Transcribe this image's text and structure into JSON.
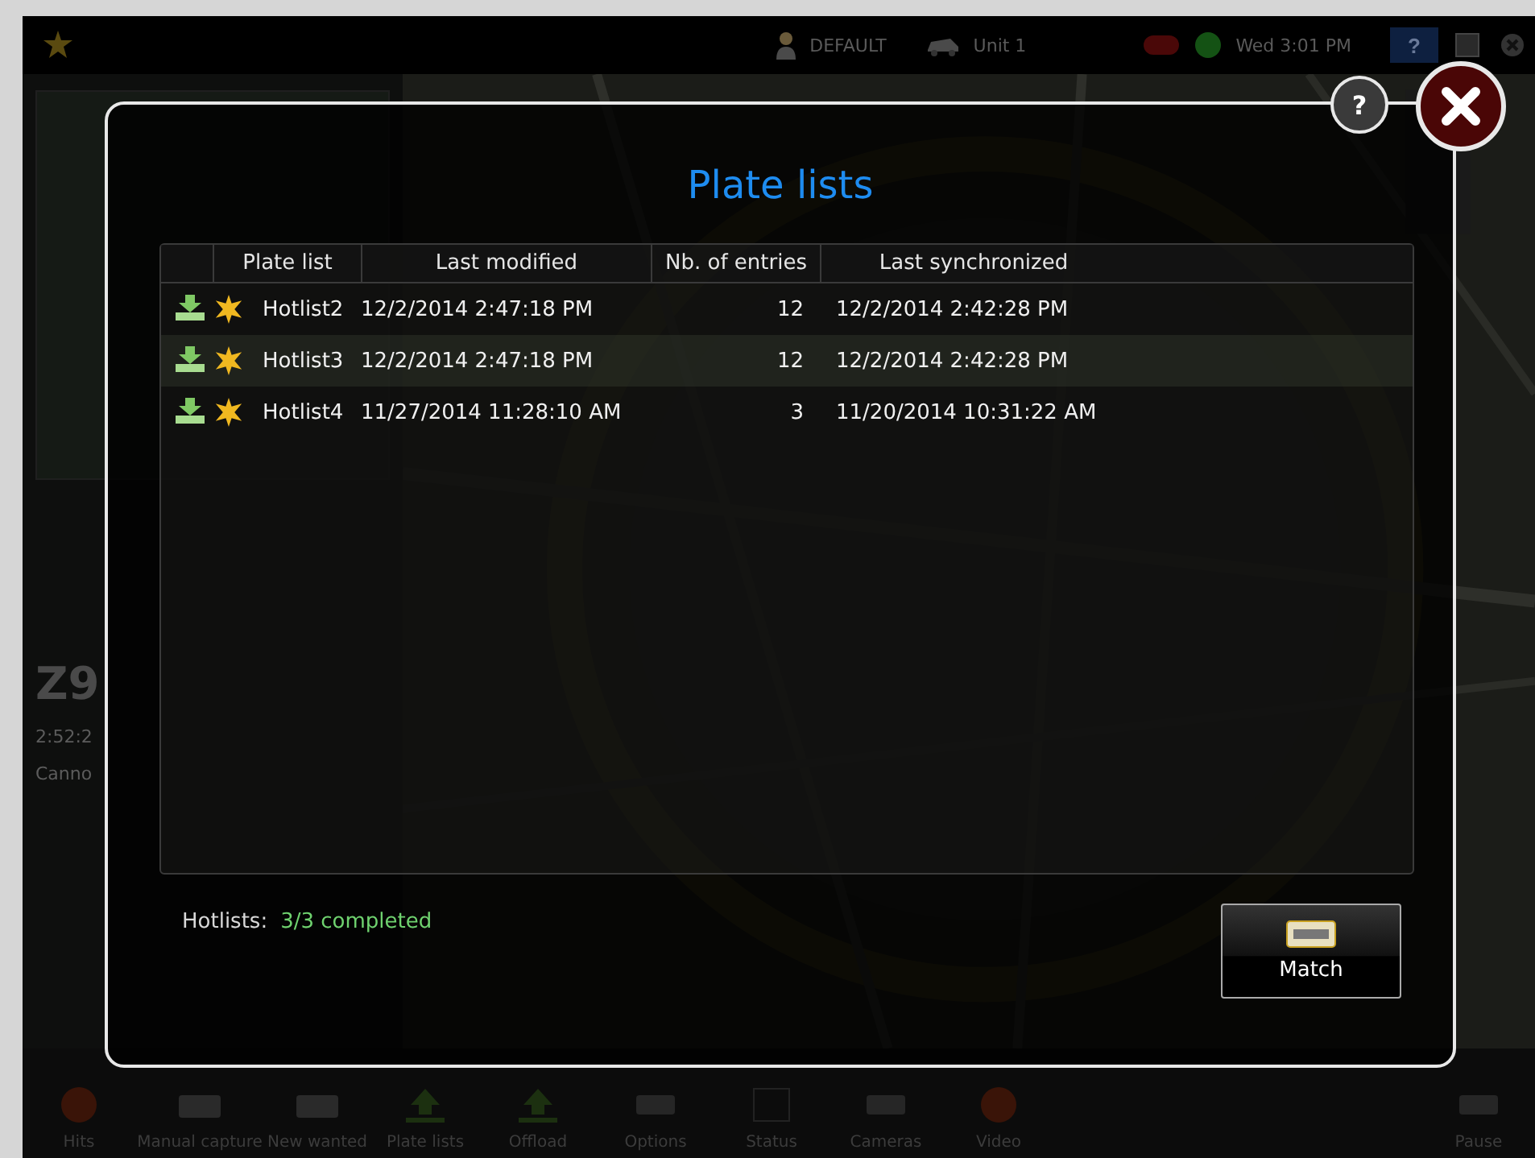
{
  "top_bar": {
    "user": "DEFAULT",
    "unit": "Unit 1",
    "clock": "Wed 3:01 PM",
    "help": "?"
  },
  "left_panel": {
    "plate": "Z9",
    "time": "2:52:2",
    "address": "Canno"
  },
  "dialog": {
    "title": "Plate lists",
    "help": "?",
    "columns": [
      "Plate list",
      "Last modified",
      "Nb. of entries",
      "Last synchronized"
    ],
    "rows": [
      {
        "name": "Hotlist2",
        "modified": "12/2/2014 2:47:18 PM",
        "entries": "12",
        "synchronized": "12/2/2014 2:42:28 PM"
      },
      {
        "name": "Hotlist3",
        "modified": "12/2/2014 2:47:18 PM",
        "entries": "12",
        "synchronized": "12/2/2014 2:42:28 PM"
      },
      {
        "name": "Hotlist4",
        "modified": "11/27/2014 11:28:10 AM",
        "entries": "3",
        "synchronized": "11/20/2014 10:31:22 AM"
      }
    ],
    "summary": {
      "label": "Hotlists:",
      "value": "3/3 completed"
    },
    "button": "Match"
  },
  "toolbar": [
    {
      "label": "Hits"
    },
    {
      "label": "Manual capture"
    },
    {
      "label": "New wanted"
    },
    {
      "label": "Plate lists"
    },
    {
      "label": "Offload"
    },
    {
      "label": "Options"
    },
    {
      "label": "Status"
    },
    {
      "label": "Cameras"
    },
    {
      "label": "Video"
    },
    {
      "label": "Pause"
    }
  ]
}
